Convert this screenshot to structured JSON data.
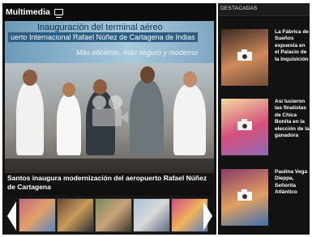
{
  "multimedia": {
    "title": "Multimedia",
    "main": {
      "banner_line1": "Inauguración del terminal aéreo",
      "banner_line2": "uerto Internacional Rafael Núñez de Cartagena de Indias",
      "banner_line3": "Más eficiente, más seguro y moderno",
      "caption": "Santos inaugura modernización del aeropuerto Rafael Núñez de Cartagena"
    },
    "thumbnails": [
      {
        "colors": [
          "#c46a7e",
          "#e0a06a",
          "#5a86c0"
        ]
      },
      {
        "colors": [
          "#6a4a33",
          "#c89a5b",
          "#2f2f2f"
        ]
      },
      {
        "colors": [
          "#7a8a60",
          "#caa27c",
          "#3d3a2a"
        ]
      },
      {
        "colors": [
          "#a9c3d8",
          "#d9d9d9",
          "#5d6d84"
        ]
      },
      {
        "colors": [
          "#cc4d8a",
          "#f0b35a",
          "#5b7bc8"
        ]
      }
    ]
  },
  "destacadas": {
    "title": "DESTACADAS",
    "items": [
      {
        "title": "La Fábrica de Sueños expuesta en el Palacio de la Inquisición",
        "colors": [
          "#3a2a22",
          "#d08a5a",
          "#6f4c38"
        ]
      },
      {
        "title": "Así lucieron las finalistas de Chica Bonita en la elección de la ganadora",
        "colors": [
          "#f2d9a0",
          "#d44f7b",
          "#8f6bb5"
        ]
      },
      {
        "title": "Paulina Vega Dieppa, Señorita Atlántico",
        "colors": [
          "#8a3a6a",
          "#e0a060",
          "#3d6fb0"
        ]
      }
    ]
  }
}
